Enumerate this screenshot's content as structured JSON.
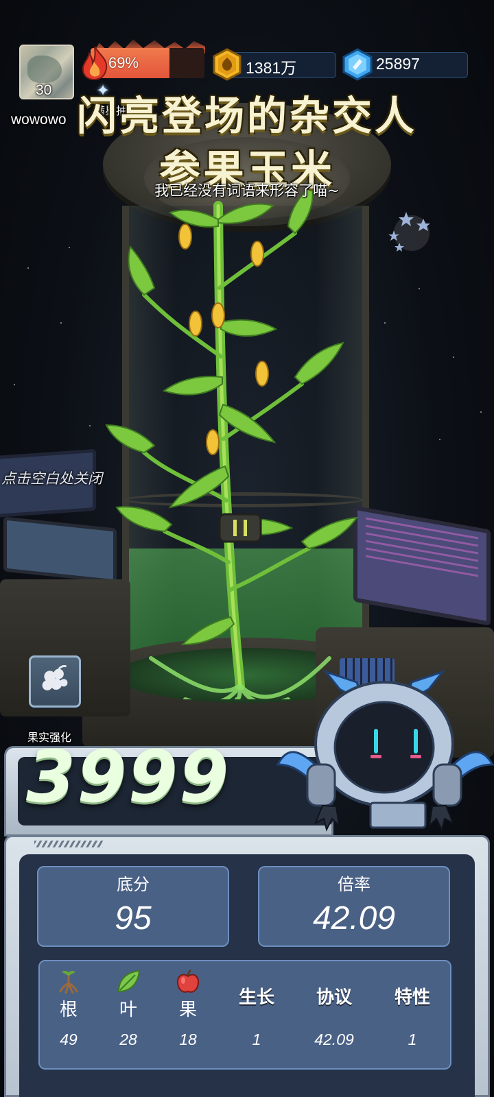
{
  "player": {
    "level": "30",
    "username": "wowowo"
  },
  "energy": {
    "percent_text": "69%",
    "fill_fraction": 0.69,
    "lottery_label": "满星抽奖"
  },
  "currency": {
    "coins": "1381万",
    "gems": "25897"
  },
  "reveal": {
    "title_line1": "闪亮登场的杂交人",
    "title_line2": "参果玉米",
    "subtitle": "我已经没有词语来形容了喵~"
  },
  "close_hint": "点击空白处关闭",
  "fruit_enhance_label": "果实强化",
  "score": {
    "total": "3999",
    "base_label": "底分",
    "base_value": "95",
    "multiplier_label": "倍率",
    "multiplier_value": "42.09"
  },
  "breakdown": {
    "columns": [
      {
        "label": "根",
        "value": "49",
        "icon": "root-icon"
      },
      {
        "label": "叶",
        "value": "28",
        "icon": "leaf-icon"
      },
      {
        "label": "果",
        "value": "18",
        "icon": "apple-icon"
      },
      {
        "label": "生长",
        "value": "1"
      },
      {
        "label": "协议",
        "value": "42.09"
      },
      {
        "label": "特性",
        "value": "1"
      }
    ]
  },
  "colors": {
    "energy": "#e3553b",
    "title": "#f7f3d2",
    "panel": "#253247",
    "stat_box": "#4a6186",
    "score": "#e9ffe0",
    "liquid": "#3f9a4a"
  }
}
